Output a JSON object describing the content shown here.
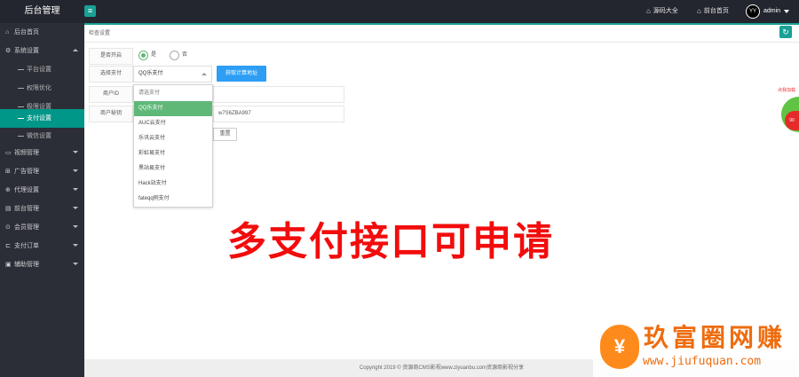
{
  "header": {
    "app_title": "后台管理",
    "toggle_icon": "≡",
    "nav": [
      {
        "icon": "⌂",
        "label": "源码大全"
      },
      {
        "icon": "⌂",
        "label": "前台首页"
      }
    ],
    "avatar_text": "YY",
    "user": "admin"
  },
  "sidebar": {
    "items": [
      {
        "icon": "⌂",
        "label": "后台首页"
      },
      {
        "icon": "⚙",
        "label": "系统设置"
      },
      {
        "label": "平台设置"
      },
      {
        "label": "权限优化"
      },
      {
        "label": "极限设置"
      },
      {
        "label": "支付设置"
      },
      {
        "label": "微信设置"
      },
      {
        "icon": "▭",
        "label": "视频管理"
      },
      {
        "icon": "⊞",
        "label": "广告管理"
      },
      {
        "icon": "⊕",
        "label": "代理设置"
      },
      {
        "icon": "▤",
        "label": "前台管理"
      },
      {
        "icon": "⊙",
        "label": "会员管理"
      },
      {
        "icon": "⊏",
        "label": "支付订单"
      },
      {
        "icon": "▣",
        "label": "辅助管理"
      }
    ]
  },
  "tabbar": {
    "crumb": "检查设置",
    "refresh_icon": "↻"
  },
  "form": {
    "switch_label": "是否开启",
    "radio_yes": "是",
    "radio_no": "否",
    "pay_label": "选择支付",
    "pay_selected": "QQ乐支付",
    "fetch_button": "获取计算地址",
    "merchant_label": "商户ID",
    "key_label": "商户秘钥",
    "key_value": "w7S6ZBA997",
    "reset_button": "重置"
  },
  "dropdown": {
    "options": [
      "请选支付",
      "QQ乐支付",
      "AUC云支付",
      "乐讯云支付",
      "彩虹易支付",
      "黑站易支付",
      "Hack站支付",
      "fateqq例支付"
    ]
  },
  "banner_text": "多支付接口可申请",
  "footer": "Copyright 2019 © 资源商CMS影视www.ziyuanbu.com资源商影视分享",
  "float_badge": {
    "title": "点我加载",
    "value": "90"
  },
  "watermark": {
    "logo_char": "¥",
    "cn": "玖富圈网赚",
    "url": "www.jiufuquan.com"
  }
}
